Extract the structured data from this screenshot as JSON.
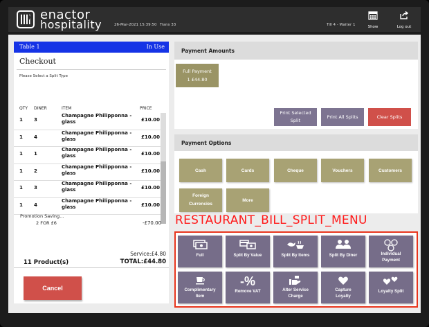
{
  "header": {
    "brand_line1": "enactor",
    "brand_line2": "hospitality",
    "datetime": "26-Mar-2021 15:39:50",
    "trans": "Trans 33",
    "till": "Till 4 - Waiter 1",
    "show_label": "Show",
    "logout_label": "Log out"
  },
  "order": {
    "table": "Table 1",
    "status": "In Use",
    "title": "Checkout",
    "hint": "Please Select a Split Type",
    "columns": [
      "QTY",
      "DINER",
      "ITEM",
      "PRICE"
    ],
    "rows": [
      {
        "qty": "1",
        "diner": "3",
        "item": "Champagne Philipponna - glass",
        "price": "£10.00"
      },
      {
        "qty": "1",
        "diner": "4",
        "item": "Champagne Philipponna - glass",
        "price": "£10.00"
      },
      {
        "qty": "1",
        "diner": "1",
        "item": "Champagne Philipponna - glass",
        "price": "£10.00"
      },
      {
        "qty": "1",
        "diner": "2",
        "item": "Champagne Philipponna - glass",
        "price": "£10.00"
      },
      {
        "qty": "1",
        "diner": "3",
        "item": "Champagne Philipponna - glass",
        "price": "£10.00"
      },
      {
        "qty": "1",
        "diner": "4",
        "item": "Champagne Philipponna - glass",
        "price": "£10.00"
      }
    ],
    "promotion_label": "Promotion Saving...",
    "promotion_detail": "2 FOR £6",
    "promotion_value": "-£70.00",
    "service": "Service:£4.80",
    "product_count": "11 Product(s)",
    "total": "TOTAL:£44.80",
    "cancel_label": "Cancel"
  },
  "payment": {
    "amounts_title": "Payment Amounts",
    "full_payment_line1": "Full Payment",
    "full_payment_line2": "1 £44.80",
    "print_selected_line1": "Print Selected",
    "print_selected_line2": "Split",
    "print_all": "Print All Splits",
    "clear": "Clear Splits",
    "options_title": "Payment Options",
    "options": [
      "Cash",
      "Cards",
      "Cheque",
      "Vouchers",
      "Customers"
    ],
    "foreign_line1": "Foreign",
    "foreign_line2": "Currencies",
    "more": "More"
  },
  "split_menu": {
    "label": "RESTAURANT_BILL_SPLIT_MENU",
    "buttons": [
      {
        "line1": "Full",
        "line2": "",
        "icon": "banknotes-icon"
      },
      {
        "line1": "Split By Value",
        "line2": "",
        "icon": "card-cash-icon"
      },
      {
        "line1": "Split By Items",
        "line2": "",
        "icon": "food-items-icon"
      },
      {
        "line1": "Split By Diner",
        "line2": "",
        "icon": "diners-icon"
      },
      {
        "line1": "Individual",
        "line2": "Payment",
        "icon": "coins-icon"
      },
      {
        "line1": "Complimentary",
        "line2": "Item",
        "icon": "coffee-cup-icon"
      },
      {
        "line1": "Remove VAT",
        "line2": "",
        "icon": "percent-icon"
      },
      {
        "line1": "Alter Service",
        "line2": "Charge",
        "icon": "hand-service-icon"
      },
      {
        "line1": "Capture",
        "line2": "Loyalty",
        "icon": "heart-icon"
      },
      {
        "line1": "Loyalty Split",
        "line2": "",
        "icon": "hearts-icon"
      }
    ]
  },
  "colors": {
    "table_bar": "#1533e6",
    "cancel": "#d0504a",
    "split_button": "#766d89",
    "option_button": "#a8a274",
    "highlight": "#e8341c"
  }
}
